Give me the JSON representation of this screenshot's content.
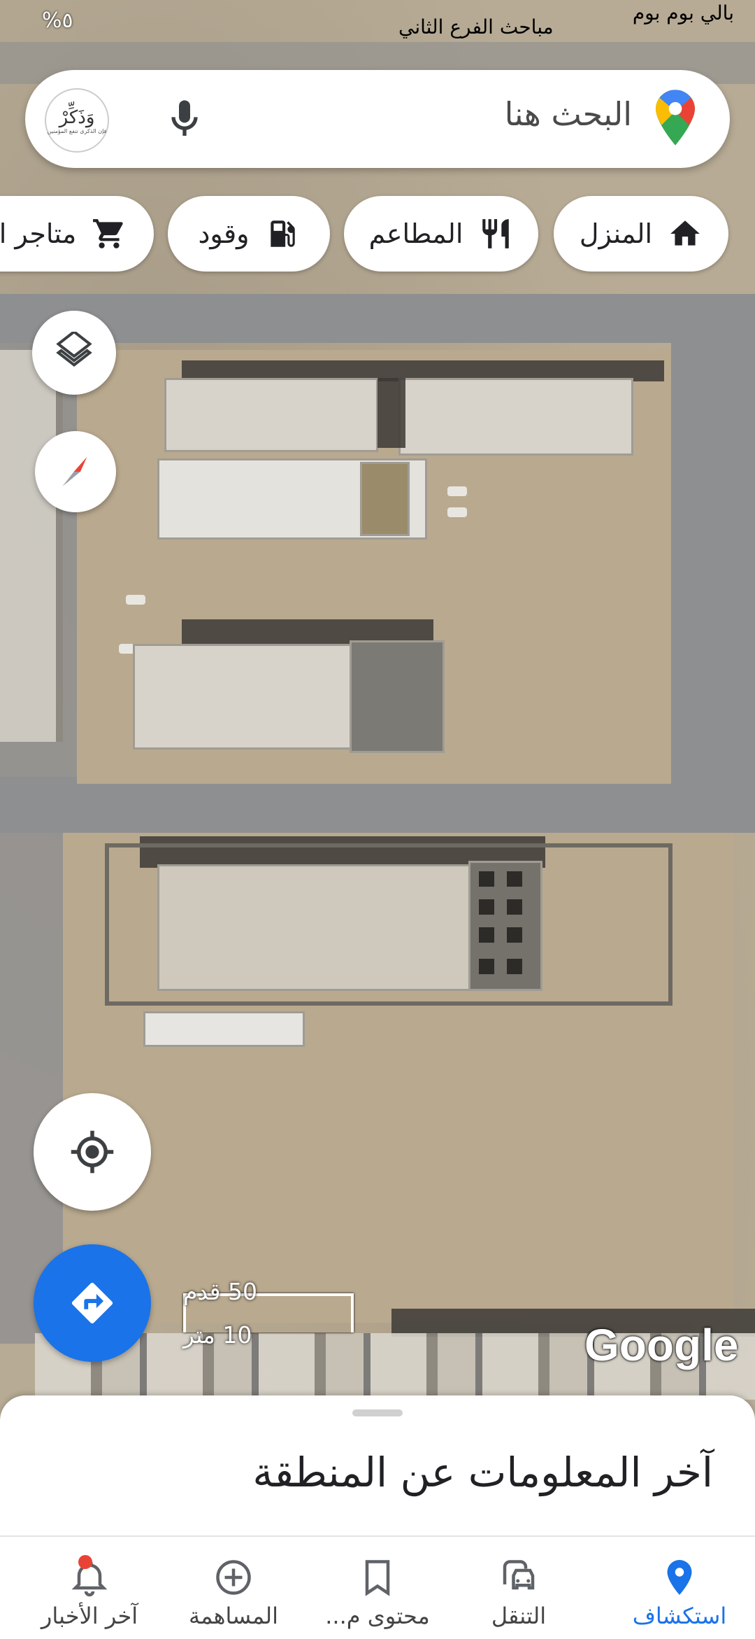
{
  "status_bar": {
    "left_text": "%٥",
    "right_text": "بالي بوم بوم",
    "center_text": "مباحث الفرع الثاني"
  },
  "search": {
    "placeholder": "البحث هنا",
    "avatar_text": "وَذَكِّرْ",
    "avatar_subtext": "فإن الذكرى تنفع المؤمنين"
  },
  "chips": [
    {
      "label": "المنزل",
      "icon": "home-icon"
    },
    {
      "label": "المطاعم",
      "icon": "restaurant-icon"
    },
    {
      "label": "وقود",
      "icon": "gas-station-icon"
    },
    {
      "label": "متاجر ا",
      "icon": "shopping-cart-icon"
    }
  ],
  "map": {
    "scale_top": "50 قدم",
    "scale_bottom": "10 متر",
    "watermark": "Google"
  },
  "sheet": {
    "title": "آخر المعلومات عن المنطقة"
  },
  "nav": [
    {
      "label": "استكشاف",
      "icon": "explore-pin-icon",
      "active": true
    },
    {
      "label": "التنقل",
      "icon": "commute-icon",
      "active": false
    },
    {
      "label": "محتوى م...",
      "icon": "saved-bookmark-icon",
      "active": false
    },
    {
      "label": "المساهمة",
      "icon": "contribute-plus-icon",
      "active": false
    },
    {
      "label": "آخر الأخبار",
      "icon": "updates-bell-icon",
      "active": false
    }
  ],
  "colors": {
    "accent": "#1a73e8",
    "notification": "#ea4335",
    "directions_fab": "#1a73e8"
  }
}
